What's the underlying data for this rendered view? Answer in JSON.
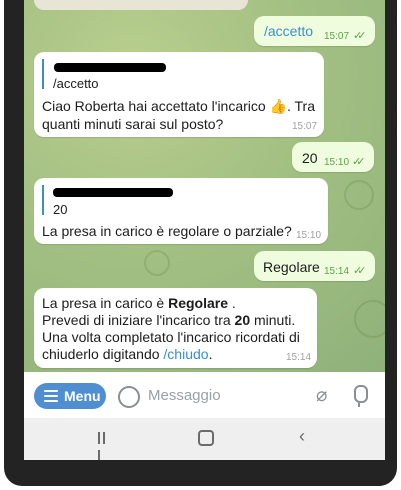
{
  "messages": {
    "m1": {
      "text": "/accetto",
      "time": "15:07"
    },
    "m2": {
      "reply_quote": "/accetto",
      "line1": "Ciao Roberta hai accettato l'incarico 👍. Tra",
      "line2": "quanti minuti sarai sul posto?",
      "time": "15:07"
    },
    "m3": {
      "text": "20",
      "time": "15:10"
    },
    "m4": {
      "reply_quote": "20",
      "text": "La presa in carico è regolare o parziale?",
      "time": "15:10"
    },
    "m5": {
      "text": "Regolare",
      "time": "15:14"
    },
    "m6": {
      "l1_pre": "La presa in carico è ",
      "l1_bold": "Regolare",
      "l1_post": " .",
      "l2_pre": " Prevedi di iniziare l'incarico tra ",
      "l2_bold": "20",
      "l2_post": " minuti.",
      "l3": " Una volta completato l'incarico ricordati di",
      "l4_pre": "chiuderlo digitando ",
      "l4_link": "/chiudo",
      "l4_post": ".",
      "time": "15:14"
    }
  },
  "composer": {
    "menu_label": "Menu",
    "placeholder": "Messaggio"
  },
  "colors": {
    "outgoing_bubble": "#effdde",
    "incoming_bubble": "#ffffff",
    "menu_button": "#4f8fd1",
    "link": "#3a8fcf"
  }
}
